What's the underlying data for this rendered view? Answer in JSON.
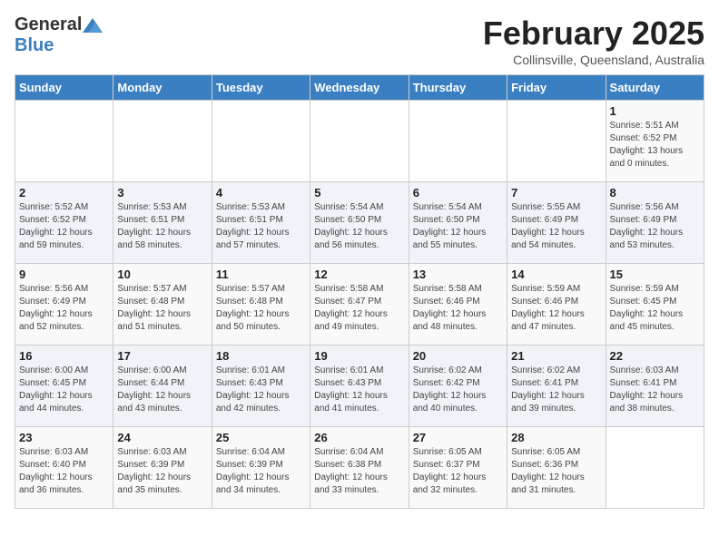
{
  "header": {
    "logo_general": "General",
    "logo_blue": "Blue",
    "month": "February 2025",
    "location": "Collinsville, Queensland, Australia"
  },
  "weekdays": [
    "Sunday",
    "Monday",
    "Tuesday",
    "Wednesday",
    "Thursday",
    "Friday",
    "Saturday"
  ],
  "weeks": [
    [
      {
        "day": "",
        "info": ""
      },
      {
        "day": "",
        "info": ""
      },
      {
        "day": "",
        "info": ""
      },
      {
        "day": "",
        "info": ""
      },
      {
        "day": "",
        "info": ""
      },
      {
        "day": "",
        "info": ""
      },
      {
        "day": "1",
        "info": "Sunrise: 5:51 AM\nSunset: 6:52 PM\nDaylight: 13 hours\nand 0 minutes."
      }
    ],
    [
      {
        "day": "2",
        "info": "Sunrise: 5:52 AM\nSunset: 6:52 PM\nDaylight: 12 hours\nand 59 minutes."
      },
      {
        "day": "3",
        "info": "Sunrise: 5:53 AM\nSunset: 6:51 PM\nDaylight: 12 hours\nand 58 minutes."
      },
      {
        "day": "4",
        "info": "Sunrise: 5:53 AM\nSunset: 6:51 PM\nDaylight: 12 hours\nand 57 minutes."
      },
      {
        "day": "5",
        "info": "Sunrise: 5:54 AM\nSunset: 6:50 PM\nDaylight: 12 hours\nand 56 minutes."
      },
      {
        "day": "6",
        "info": "Sunrise: 5:54 AM\nSunset: 6:50 PM\nDaylight: 12 hours\nand 55 minutes."
      },
      {
        "day": "7",
        "info": "Sunrise: 5:55 AM\nSunset: 6:49 PM\nDaylight: 12 hours\nand 54 minutes."
      },
      {
        "day": "8",
        "info": "Sunrise: 5:56 AM\nSunset: 6:49 PM\nDaylight: 12 hours\nand 53 minutes."
      }
    ],
    [
      {
        "day": "9",
        "info": "Sunrise: 5:56 AM\nSunset: 6:49 PM\nDaylight: 12 hours\nand 52 minutes."
      },
      {
        "day": "10",
        "info": "Sunrise: 5:57 AM\nSunset: 6:48 PM\nDaylight: 12 hours\nand 51 minutes."
      },
      {
        "day": "11",
        "info": "Sunrise: 5:57 AM\nSunset: 6:48 PM\nDaylight: 12 hours\nand 50 minutes."
      },
      {
        "day": "12",
        "info": "Sunrise: 5:58 AM\nSunset: 6:47 PM\nDaylight: 12 hours\nand 49 minutes."
      },
      {
        "day": "13",
        "info": "Sunrise: 5:58 AM\nSunset: 6:46 PM\nDaylight: 12 hours\nand 48 minutes."
      },
      {
        "day": "14",
        "info": "Sunrise: 5:59 AM\nSunset: 6:46 PM\nDaylight: 12 hours\nand 47 minutes."
      },
      {
        "day": "15",
        "info": "Sunrise: 5:59 AM\nSunset: 6:45 PM\nDaylight: 12 hours\nand 45 minutes."
      }
    ],
    [
      {
        "day": "16",
        "info": "Sunrise: 6:00 AM\nSunset: 6:45 PM\nDaylight: 12 hours\nand 44 minutes."
      },
      {
        "day": "17",
        "info": "Sunrise: 6:00 AM\nSunset: 6:44 PM\nDaylight: 12 hours\nand 43 minutes."
      },
      {
        "day": "18",
        "info": "Sunrise: 6:01 AM\nSunset: 6:43 PM\nDaylight: 12 hours\nand 42 minutes."
      },
      {
        "day": "19",
        "info": "Sunrise: 6:01 AM\nSunset: 6:43 PM\nDaylight: 12 hours\nand 41 minutes."
      },
      {
        "day": "20",
        "info": "Sunrise: 6:02 AM\nSunset: 6:42 PM\nDaylight: 12 hours\nand 40 minutes."
      },
      {
        "day": "21",
        "info": "Sunrise: 6:02 AM\nSunset: 6:41 PM\nDaylight: 12 hours\nand 39 minutes."
      },
      {
        "day": "22",
        "info": "Sunrise: 6:03 AM\nSunset: 6:41 PM\nDaylight: 12 hours\nand 38 minutes."
      }
    ],
    [
      {
        "day": "23",
        "info": "Sunrise: 6:03 AM\nSunset: 6:40 PM\nDaylight: 12 hours\nand 36 minutes."
      },
      {
        "day": "24",
        "info": "Sunrise: 6:03 AM\nSunset: 6:39 PM\nDaylight: 12 hours\nand 35 minutes."
      },
      {
        "day": "25",
        "info": "Sunrise: 6:04 AM\nSunset: 6:39 PM\nDaylight: 12 hours\nand 34 minutes."
      },
      {
        "day": "26",
        "info": "Sunrise: 6:04 AM\nSunset: 6:38 PM\nDaylight: 12 hours\nand 33 minutes."
      },
      {
        "day": "27",
        "info": "Sunrise: 6:05 AM\nSunset: 6:37 PM\nDaylight: 12 hours\nand 32 minutes."
      },
      {
        "day": "28",
        "info": "Sunrise: 6:05 AM\nSunset: 6:36 PM\nDaylight: 12 hours\nand 31 minutes."
      },
      {
        "day": "",
        "info": ""
      }
    ]
  ]
}
